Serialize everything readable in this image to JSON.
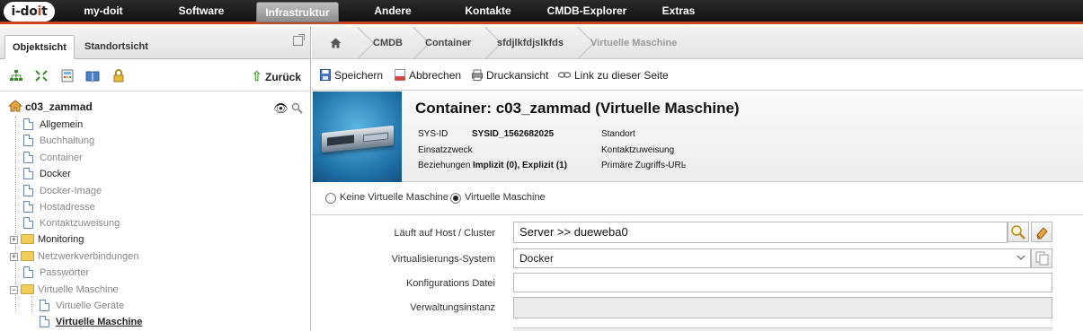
{
  "topnav": {
    "logo_text_pre": "i-do",
    "logo_text_dot": "i",
    "logo_text_post": "t",
    "items": [
      "my-doit",
      "Software",
      "Infrastruktur",
      "Andere",
      "Kontakte",
      "CMDB-Explorer",
      "Extras"
    ],
    "active": "Infrastruktur",
    "accent": "#c9451f"
  },
  "left": {
    "tabs": [
      "Objektsicht",
      "Standortsicht"
    ],
    "back_label": "Zurück",
    "toolbar_icons": [
      "network-tree-icon",
      "expand-icon",
      "calculator-icon",
      "book-icon",
      "lock-icon"
    ],
    "root": "c03_zammad",
    "nodes": [
      "Allgemein",
      "Buchhaltung",
      "Container",
      "Docker",
      "Docker-Image",
      "Hostadresse",
      "Kontaktzuweisung",
      "Monitoring",
      "Netzwerkverbindungen",
      "Passwörter",
      "Virtuelle Maschine",
      "Virtuelle Geräte",
      "Virtuelle Maschine"
    ]
  },
  "breadcrumb": [
    "CMDB",
    "Container",
    "sfdjlkfdjslkfds",
    "Virtuelle Maschine"
  ],
  "actions": [
    "Speichern",
    "Abbrechen",
    "Druckansicht",
    "Link zu dieser Seite"
  ],
  "header": {
    "title": "Container: c03_zammad (Virtuelle Maschine)",
    "sysid_label": "SYS-ID",
    "sysid_value": "SYSID_1562682025",
    "einsatz_label": "Einsatzzweck",
    "bez_label": "Beziehungen",
    "bez_value": "Implizit (0), Explizit (1)",
    "standort_label": "Standort",
    "kontakt_label": "Kontaktzuweisung",
    "url_label": "Primäre Zugriffs-URL",
    "url_value": "-"
  },
  "vm_options": {
    "option1": "Keine Virtuelle Maschine",
    "option2": "Virtuelle Maschine",
    "selected": "Virtuelle Maschine"
  },
  "form": {
    "host_label": "Läuft auf Host / Cluster",
    "host_value": "Server >> dueweba0",
    "virt_label": "Virtualisierungs-System",
    "virt_value": "Docker",
    "config_label": "Konfigurations Datei",
    "config_value": "",
    "admin_label": "Verwaltungsinstanz",
    "admin_value": ""
  }
}
